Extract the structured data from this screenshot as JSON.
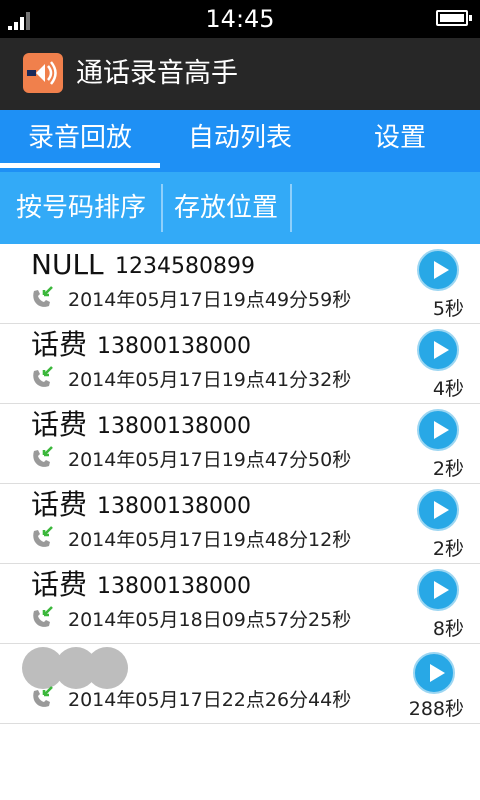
{
  "status_bar": {
    "time": "14:45",
    "icons": [
      "signal-icon",
      "battery-icon"
    ]
  },
  "app": {
    "title": "通话录音高手",
    "icon": "app-logo-icon",
    "icon_color": "#f0804c"
  },
  "tabs": [
    {
      "label": "录音回放",
      "active": true
    },
    {
      "label": "自动列表",
      "active": false
    },
    {
      "label": "设置",
      "active": false
    }
  ],
  "sub_toolbar": {
    "sort_label": "按号码排序",
    "storage_label": "存放位置"
  },
  "colors": {
    "tab_bar": "#1e90f5",
    "sub_bar": "#33aaf7",
    "play_button": "#28a8e6",
    "app_bar": "#272727"
  },
  "recordings": [
    {
      "name": "NULL",
      "number": "1234580899",
      "datetime": "2014年05月17日19点49分59秒",
      "duration": "5秒",
      "call_icon": "call-incoming-icon"
    },
    {
      "name": "话费",
      "number": "13800138000",
      "datetime": "2014年05月17日19点41分32秒",
      "duration": "4秒",
      "call_icon": "call-incoming-icon"
    },
    {
      "name": "话费",
      "number": "13800138000",
      "datetime": "2014年05月17日19点47分50秒",
      "duration": "2秒",
      "call_icon": "call-incoming-icon"
    },
    {
      "name": "话费",
      "number": "13800138000",
      "datetime": "2014年05月17日19点48分12秒",
      "duration": "2秒",
      "call_icon": "call-incoming-icon"
    },
    {
      "name": "话费",
      "number": "13800138000",
      "datetime": "2014年05月18日09点57分25秒",
      "duration": "8秒",
      "call_icon": "call-incoming-icon"
    },
    {
      "name": "",
      "number": "",
      "datetime": "2014年05月17日22点26分44秒",
      "duration": "288秒",
      "call_icon": "call-incoming-icon",
      "redacted": true
    }
  ]
}
